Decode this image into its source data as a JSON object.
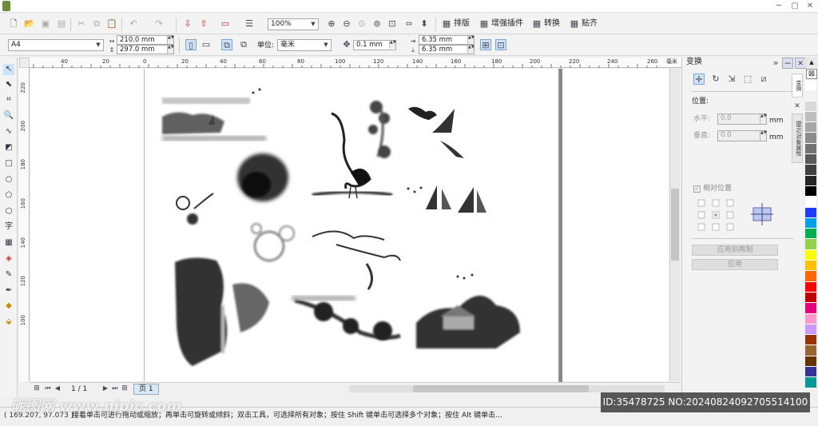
{
  "toolbar1": {
    "zoom_value": "100%",
    "menus": [
      {
        "icon": "layout-icon",
        "label": "排版"
      },
      {
        "icon": "plugin-icon",
        "label": "增强插件"
      },
      {
        "icon": "convert-icon",
        "label": "转换"
      },
      {
        "icon": "snap-icon",
        "label": "贴齐"
      }
    ]
  },
  "propbar": {
    "page_size": "A4",
    "width": "210.0 mm",
    "height": "297.0 mm",
    "unit_label": "单位:",
    "unit_value": "毫米",
    "nudge": "0.1 mm",
    "dup_x": "6.35 mm",
    "dup_y": "6.35 mm"
  },
  "ruler": {
    "h_ticks": [
      "40",
      "20",
      "0",
      "20",
      "40",
      "60",
      "80",
      "100",
      "120",
      "140",
      "160",
      "180",
      "200",
      "220",
      "240",
      "260"
    ],
    "h_unit": "毫米",
    "v_ticks": [
      "220",
      "200",
      "180",
      "160",
      "140",
      "120",
      "100"
    ]
  },
  "pagenav": {
    "counter": "1 / 1",
    "tab": "页 1"
  },
  "status": {
    "coords": "( 169.207, 97.073 )",
    "hint": "接着单击可进行拖动或缩放；再单击可旋转或倾斜；双击工具，可选择所有对象；按住 Shift 键单击可选择多个对象；按住 Alt 键单击..."
  },
  "docker": {
    "title": "变换",
    "section_position": "位置:",
    "h_label": "水平:",
    "h_value": "0.0",
    "v_label": "垂直:",
    "v_value": "0.0",
    "unit": "mm",
    "relative": "相对位置",
    "apply_dup": "应用到再制",
    "apply": "应用"
  },
  "docker_tabs": [
    "变换",
    "提示/对象属性"
  ],
  "palette": [
    "#ffffff",
    "#f2f2f2",
    "#d9d9d9",
    "#bfbfbf",
    "#a6a6a6",
    "#8c8c8c",
    "#737373",
    "#595959",
    "#404040",
    "#262626",
    "#000000",
    "#ffffff",
    "#1e3cff",
    "#00a0e9",
    "#00b050",
    "#92d050",
    "#ffff00",
    "#ffc000",
    "#ff6600",
    "#ff0000",
    "#c00000",
    "#e6007e",
    "#ff99cc",
    "#cc99ff",
    "#993300",
    "#996633",
    "#663300",
    "#333399",
    "#009999"
  ],
  "watermark": "ID:35478725 NO:20240824092705514100",
  "site_logo": "昵图网 www.nipic.com"
}
